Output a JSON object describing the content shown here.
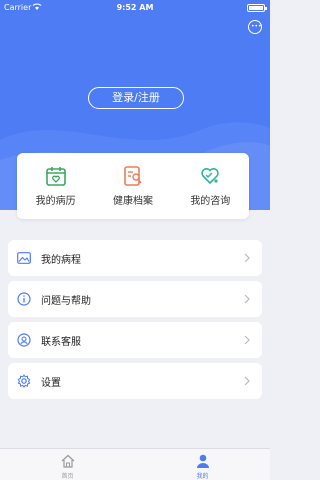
{
  "status": {
    "carrier": "Carrier",
    "time": "9:52 AM"
  },
  "header": {
    "login_label": "登录/注册"
  },
  "quick": {
    "records": "我的病历",
    "health_file": "健康档案",
    "consult": "我的咨询"
  },
  "menu": {
    "items": [
      {
        "label": "我的病程"
      },
      {
        "label": "问题与帮助"
      },
      {
        "label": "联系客服"
      },
      {
        "label": "设置"
      }
    ]
  },
  "tabs": {
    "home": "首页",
    "mine": "我的"
  },
  "colors": {
    "accent": "#4d7cf5",
    "green": "#3aa85c",
    "orange": "#f07c55",
    "teal": "#2db5a0"
  }
}
